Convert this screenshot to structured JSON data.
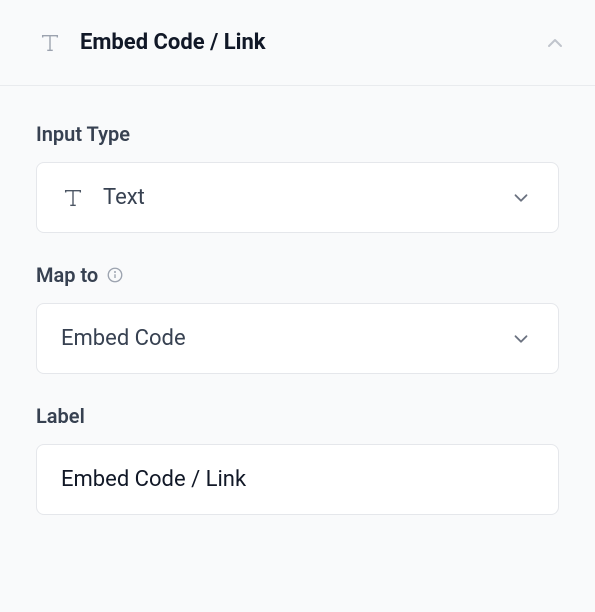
{
  "header": {
    "title": "Embed Code / Link"
  },
  "fields": {
    "inputType": {
      "label": "Input Type",
      "value": "Text"
    },
    "mapTo": {
      "label": "Map to",
      "value": "Embed Code"
    },
    "label": {
      "label": "Label",
      "value": "Embed Code / Link"
    }
  }
}
